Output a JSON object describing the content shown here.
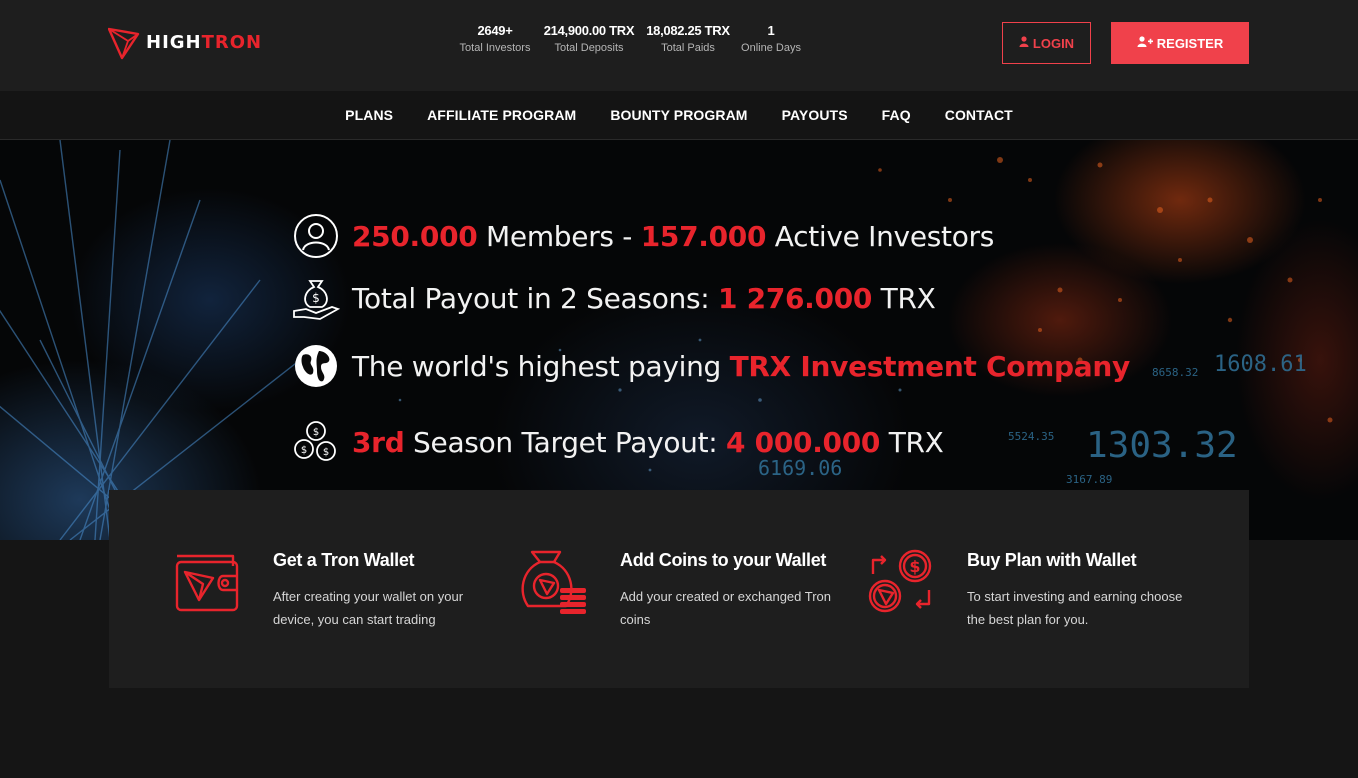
{
  "brand": {
    "name_part1": "HIGH",
    "name_part2": "TRON",
    "accent": "#e8242c",
    "button_color": "#f0414b"
  },
  "stats": [
    {
      "value": "2649+",
      "label": "Total Investors"
    },
    {
      "value": "214,900.00 TRX",
      "label": "Total Deposits"
    },
    {
      "value": "18,082.25 TRX",
      "label": "Total Paids"
    },
    {
      "value": "1",
      "label": "Online Days"
    }
  ],
  "auth": {
    "login_label": "LOGIN",
    "register_label": "REGISTER",
    "login_icon": "user-icon",
    "register_icon": "user-plus-icon"
  },
  "nav": {
    "items": [
      "PLANS",
      "AFFILIATE PROGRAM",
      "BOUNTY PROGRAM",
      "PAYOUTS",
      "FAQ",
      "CONTACT"
    ]
  },
  "hero": {
    "line1": {
      "icon": "user-circle-icon",
      "n1": "250.000",
      "t1": " Members - ",
      "n2": "157.000",
      "t2": " Active Investors"
    },
    "line2": {
      "icon": "money-bag-hand-icon",
      "t1": "Total Payout in 2 Seasons: ",
      "n1": "1 276.000",
      "t2": " TRX"
    },
    "line3": {
      "icon": "globe-icon",
      "t1": "The world's highest paying ",
      "n1": "TRX Investment Company"
    },
    "line4": {
      "icon": "coins-icon",
      "n1": "3rd",
      "t1": " Season Target Payout: ",
      "n2": "4 000.000",
      "t2": " TRX"
    },
    "tickers": [
      "1608.61",
      "1303.32",
      "6169.06",
      "8658.32",
      "5524.35",
      "3167.89"
    ]
  },
  "steps": [
    {
      "icon": "wallet-icon",
      "title": "Get a Tron Wallet",
      "desc": "After creating your wallet on your device, you can start trading"
    },
    {
      "icon": "money-bag-coins-icon",
      "title": "Add Coins to your Wallet",
      "desc": "Add your created or exchanged Tron coins"
    },
    {
      "icon": "exchange-coins-icon",
      "title": "Buy Plan with Wallet",
      "desc": "To start investing and earning choose the best plan for you."
    }
  ]
}
